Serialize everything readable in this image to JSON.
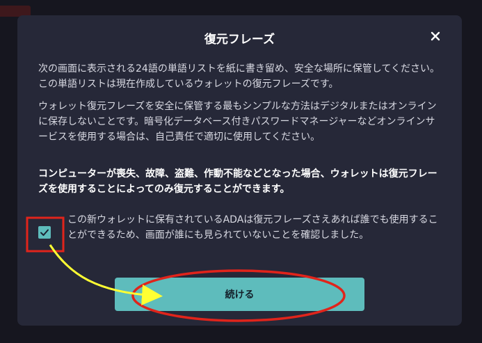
{
  "dialog": {
    "title": "復元フレーズ",
    "paragraph_1": "次の画面に表示される24語の単語リストを紙に書き留め、安全な場所に保管してください。この単語リストは現在作成しているウォレットの復元フレーズです。",
    "paragraph_2": "ウォレット復元フレーズを安全に保管する最もシンプルな方法はデジタルまたはオンラインに保存しないことです。暗号化データベース付きパスワードマネージャーなどオンラインサービスを使用する場合は、自己責任で適切に使用してください。",
    "paragraph_3": "コンピューターが喪失、故障、盗難、作動不能などとなった場合、ウォレットは復元フレーズを使用することによってのみ復元することができます。",
    "confirm_text": "この新ウォレットに保有されているADAは復元フレーズさえあれば誰でも使用することができるため、画面が誰にも見られていないことを確認しました。",
    "confirm_checked": true,
    "continue_label": "続ける",
    "close_icon": "close-icon",
    "check_icon": "check-icon"
  },
  "colors": {
    "modal_bg": "#262838",
    "accent": "#5ebcbc",
    "annotation_red": "#e0241b",
    "annotation_yellow": "#ffff33"
  }
}
